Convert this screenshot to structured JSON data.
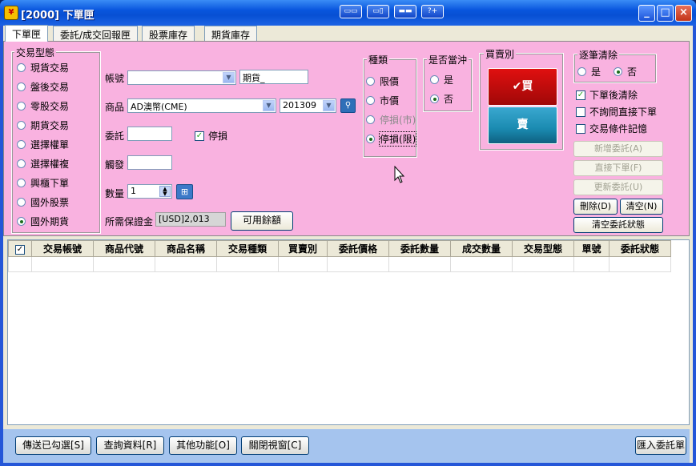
{
  "window": {
    "title": "[2000] 下單匣",
    "icon_text": "",
    "toolbar_icons": [
      "layout-icon-1",
      "layout-icon-2",
      "layout-icon-3",
      "help-icon"
    ],
    "toolbar_icon_glyphs": [
      "▭▭",
      "▭▯",
      "▬▬",
      "?+"
    ]
  },
  "tabs": [
    "下單匣",
    "委託/成交回報匣",
    "股票庫存",
    "期貨庫存"
  ],
  "trade_type": {
    "title": "交易型態",
    "options": [
      "現貨交易",
      "盤後交易",
      "零股交易",
      "期貨交易",
      "選擇權單",
      "選擇權複",
      "興櫃下單",
      "國外股票",
      "國外期貨"
    ],
    "selected": "國外期貨"
  },
  "form": {
    "account_label": "帳號",
    "account_value": "",
    "account_type": "期貨_",
    "product_label": "商品",
    "product_value": "AD澳幣(CME)",
    "month_value": "201309",
    "order_label": "委託",
    "order_value": "",
    "stoploss_label": "停損",
    "stoploss_checked": true,
    "trigger_label": "觸發",
    "trigger_value": "",
    "qty_label": "數量",
    "qty_value": "1",
    "margin_label": "所需保證金",
    "margin_value": "[USD]2,013",
    "available_button": "可用餘額"
  },
  "price_type": {
    "title": "種類",
    "options": [
      "限價",
      "市價",
      "停損(市)",
      "停損(限)"
    ],
    "selected": "停損(限)",
    "disabled": [
      "停損(市)"
    ]
  },
  "daytrade": {
    "title": "是否當沖",
    "options": [
      "是",
      "否"
    ],
    "selected": "否"
  },
  "side": {
    "title": "買賣別",
    "buy_label": "買",
    "sell_label": "賣",
    "buy_color": "#e01010",
    "sell_color": "#1a8ab0"
  },
  "clear_each": {
    "title": "逐筆清除",
    "options": [
      "是",
      "否"
    ],
    "selected": "否"
  },
  "options_checks": [
    {
      "label": "下單後清除",
      "checked": true
    },
    {
      "label": "不詢問直接下單",
      "checked": false
    },
    {
      "label": "交易條件記憶",
      "checked": false
    }
  ],
  "action_buttons": {
    "add_order": "新增委託(A)",
    "direct_order": "直接下單(F)",
    "update_order": "更新委託(U)",
    "delete": "刪除(D)",
    "clear": "清空(N)",
    "clear_status": "清空委託狀態"
  },
  "table": {
    "check_header": "✓",
    "columns": [
      "交易帳號",
      "商品代號",
      "商品名稱",
      "交易種類",
      "買賣別",
      "委託價格",
      "委託數量",
      "成交數量",
      "交易型態",
      "單號",
      "委託狀態"
    ]
  },
  "bottom_buttons": {
    "send_checked": "傳送已勾選[S]",
    "query": "查詢資料[R]",
    "other": "其他功能[O]",
    "close": "關閉視窗[C]",
    "import": "匯入委託單"
  }
}
